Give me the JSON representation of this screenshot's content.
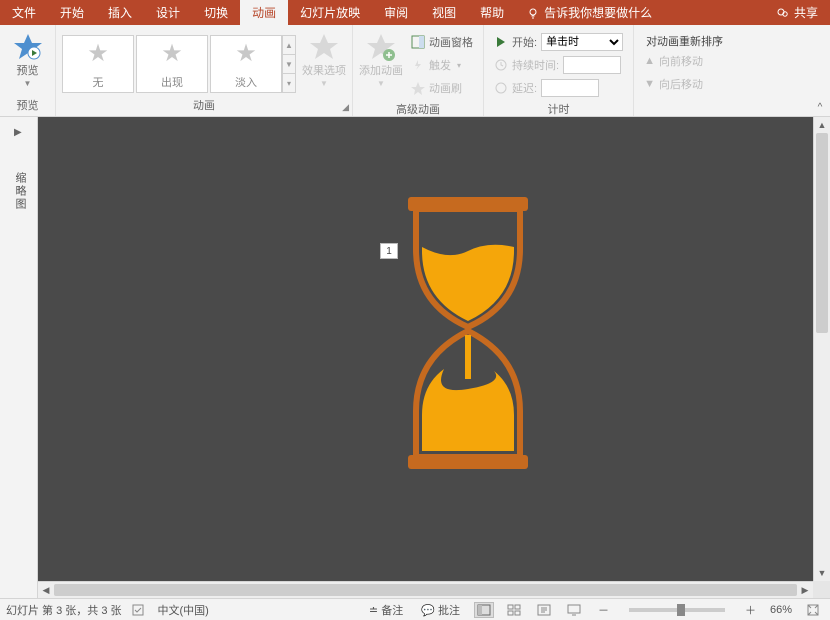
{
  "tabs": {
    "file": "文件",
    "home": "开始",
    "insert": "插入",
    "design": "设计",
    "transitions": "切换",
    "animations": "动画",
    "slideshow": "幻灯片放映",
    "review": "审阅",
    "view": "视图",
    "help": "帮助",
    "tell_me": "告诉我你想要做什么",
    "share": "共享"
  },
  "ribbon": {
    "preview": {
      "label": "预览",
      "group": "预览"
    },
    "anim": {
      "none": "无",
      "appear": "出现",
      "fade": "淡入",
      "group": "动画",
      "effect_options": "效果选项"
    },
    "advanced": {
      "add_anim": "添加动画",
      "pane": "动画窗格",
      "trigger": "触发",
      "painter": "动画刷",
      "group": "高级动画"
    },
    "timing": {
      "start_label": "开始:",
      "start_value": "单击时",
      "duration_label": "持续时间:",
      "duration_value": "",
      "delay_label": "延迟:",
      "delay_value": "",
      "group": "计时"
    },
    "reorder": {
      "title": "对动画重新排序",
      "earlier": "向前移动",
      "later": "向后移动"
    }
  },
  "thumb_pane_label": "缩略图",
  "anim_tag": "1",
  "status": {
    "slide_info": "幻灯片 第 3 张，共 3 张",
    "lang": "中文(中国)",
    "notes": "备注",
    "comments": "批注",
    "zoom": "66%"
  }
}
